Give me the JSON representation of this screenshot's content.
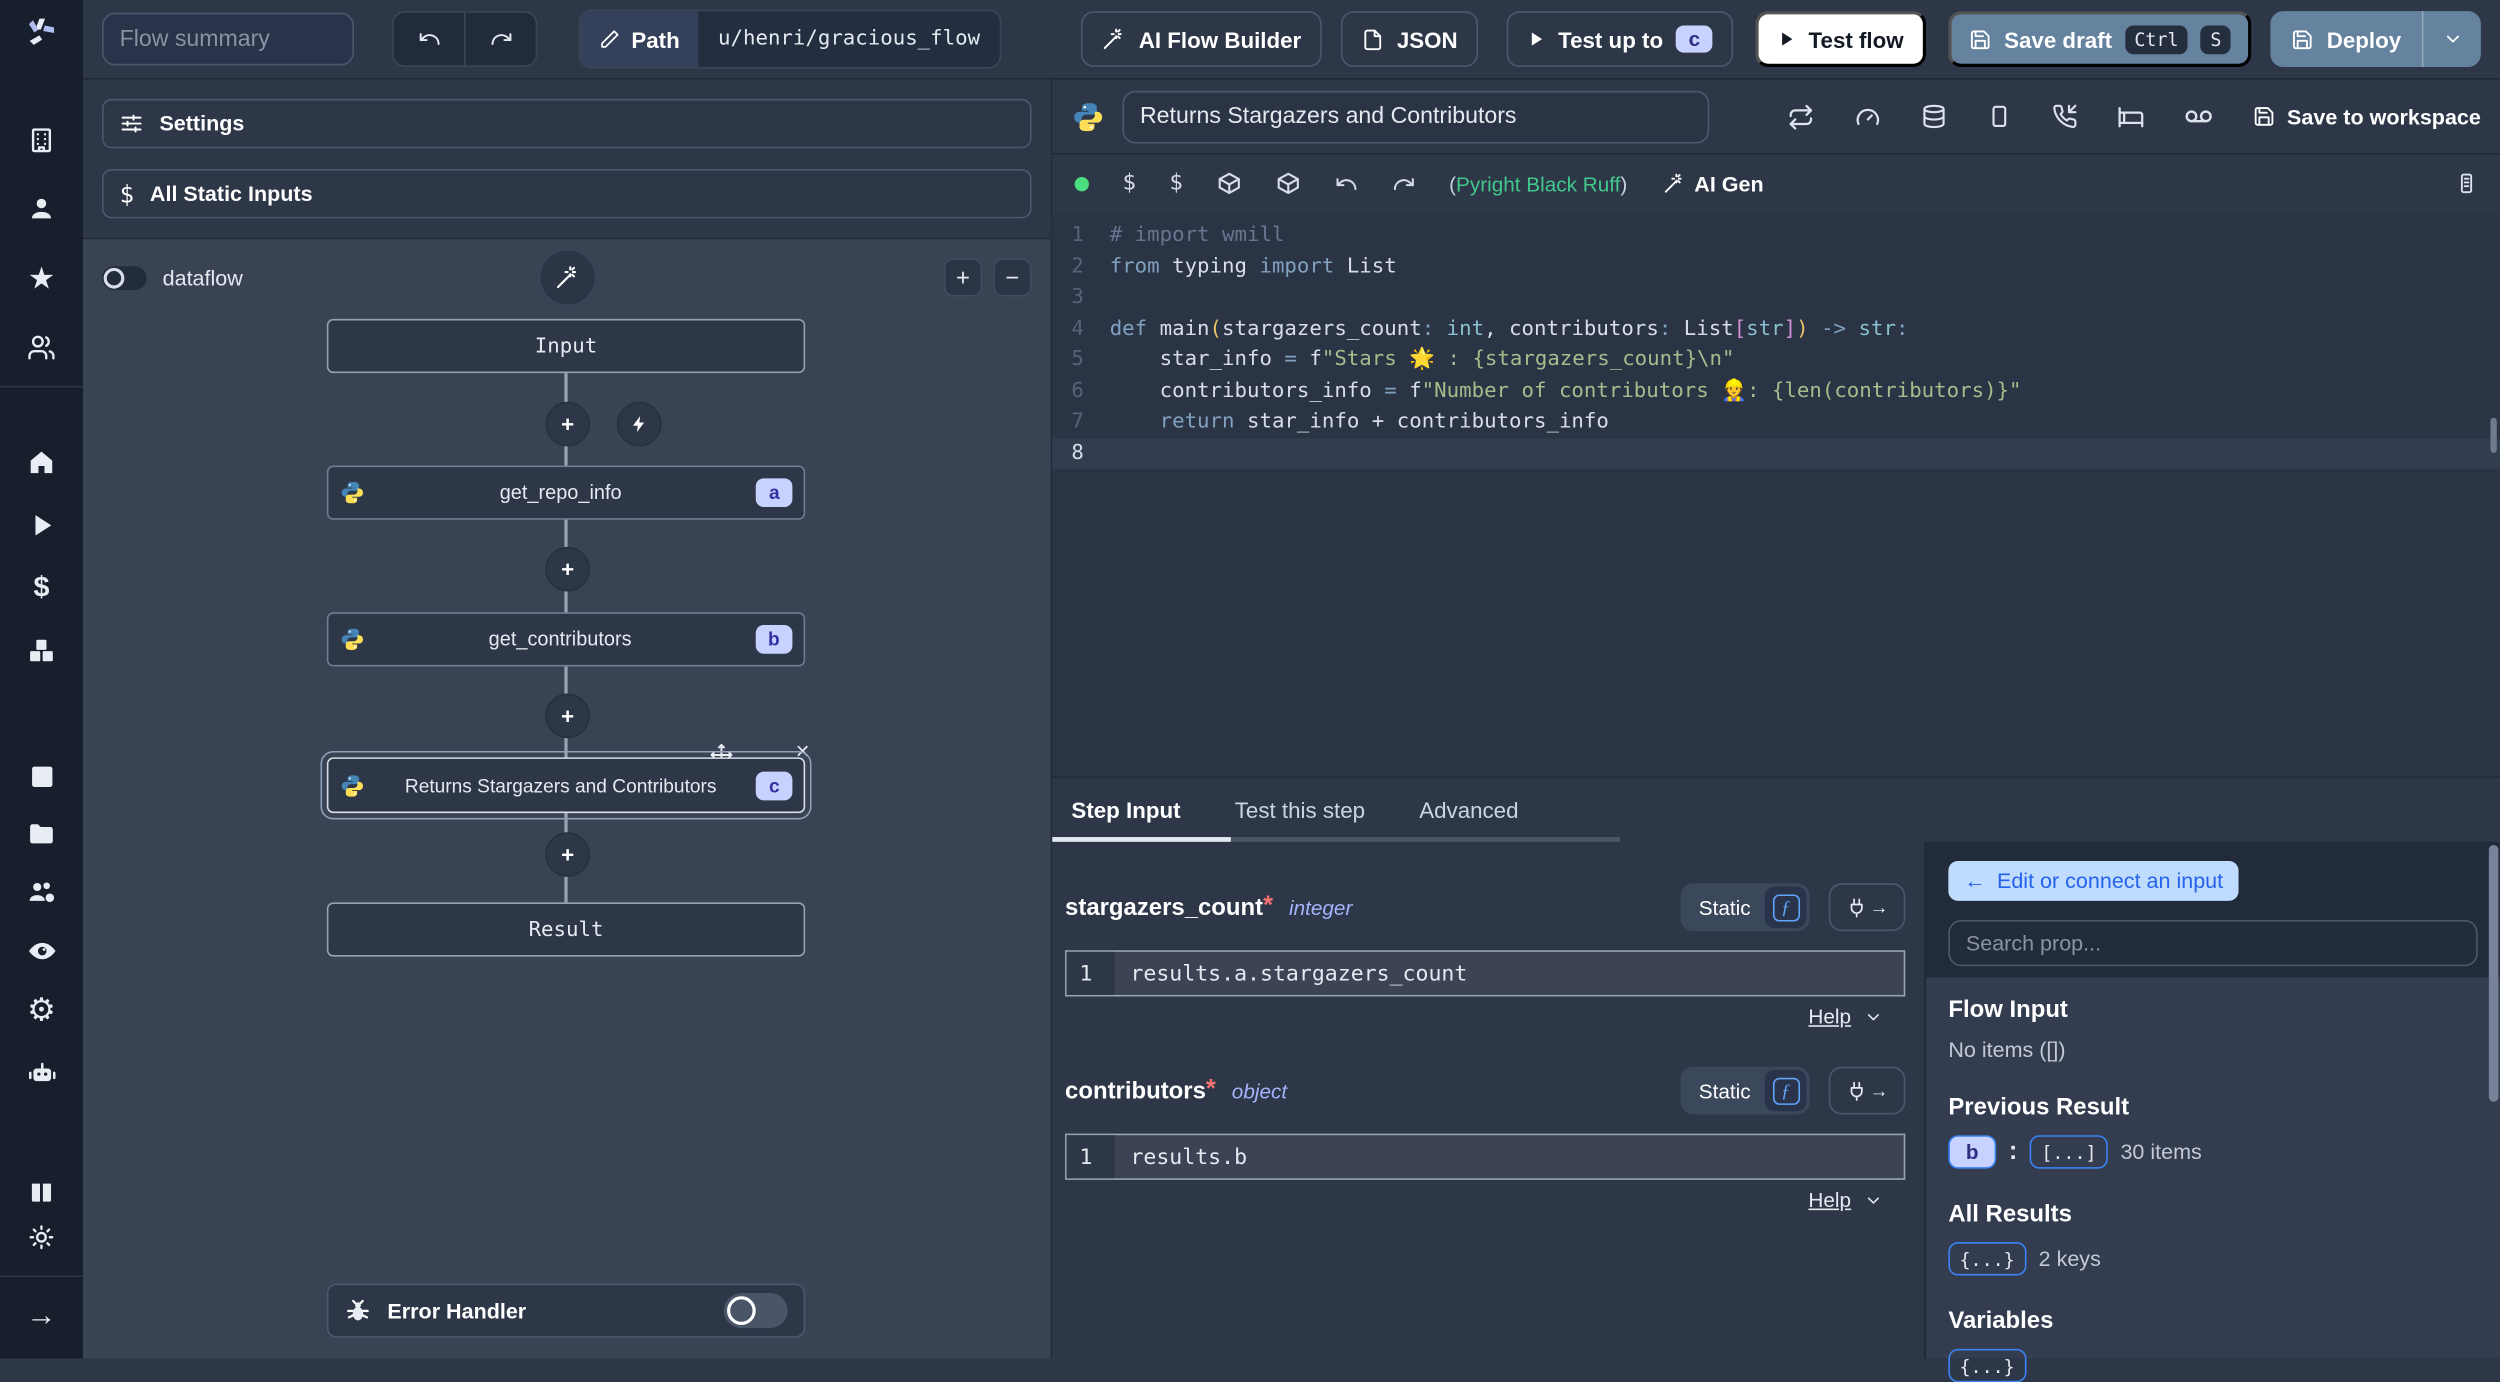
{
  "topbar": {
    "flow_summary_placeholder": "Flow summary",
    "path_label": "Path",
    "path_value": "u/henri/gracious_flow",
    "ai_flow_builder_label": "AI Flow Builder",
    "json_label": "JSON",
    "test_up_to_label": "Test up to",
    "test_up_to_badge": "c",
    "test_flow_label": "Test flow",
    "save_draft_label": "Save draft",
    "kbd_ctrl": "Ctrl",
    "kbd_s": "S",
    "deploy_label": "Deploy"
  },
  "sidebar_icons": [
    "windmill-logo",
    "building",
    "user",
    "star",
    "users",
    "home",
    "play",
    "dollar",
    "boxes",
    "calendar",
    "folder",
    "users-cog",
    "eye",
    "gear",
    "robot",
    "book",
    "sun",
    "arrow-right"
  ],
  "flow": {
    "settings_label": "Settings",
    "static_inputs_label": "All Static Inputs",
    "dataflow_label": "dataflow",
    "plus_label": "+",
    "minus_label": "−",
    "input_label": "Input",
    "result_label": "Result",
    "error_handler_label": "Error Handler",
    "steps": [
      {
        "label": "get_repo_info",
        "badge": "a"
      },
      {
        "label": "get_contributors",
        "badge": "b"
      },
      {
        "label": "Returns Stargazers and Contributors",
        "badge": "c"
      }
    ]
  },
  "editor": {
    "language": "python",
    "title": "Returns Stargazers and Contributors",
    "save_to_workspace_label": "Save to workspace",
    "lint_prefix": "(",
    "lint_text": "Pyright Black Ruff",
    "lint_suffix": ")",
    "ai_gen_label": "AI Gen",
    "dollar1": "$",
    "dollar2": "$"
  },
  "code": {
    "lines": [
      {
        "no": "1",
        "tokens": [
          {
            "c": "comment",
            "t": "# import wmill"
          }
        ]
      },
      {
        "no": "2",
        "tokens": [
          {
            "c": "keyword",
            "t": "from"
          },
          {
            "c": "plain",
            "t": " typing "
          },
          {
            "c": "keyword",
            "t": "import"
          },
          {
            "c": "plain",
            "t": " List"
          }
        ]
      },
      {
        "no": "3",
        "tokens": []
      },
      {
        "no": "4",
        "tokens": [
          {
            "c": "keyword",
            "t": "def"
          },
          {
            "c": "plain",
            "t": " main"
          },
          {
            "c": "paren",
            "t": "("
          },
          {
            "c": "plain",
            "t": "stargazers_count"
          },
          {
            "c": "keyword",
            "t": ":"
          },
          {
            "c": "plain",
            "t": " "
          },
          {
            "c": "type",
            "t": "int"
          },
          {
            "c": "plain",
            "t": ", contributors"
          },
          {
            "c": "keyword",
            "t": ":"
          },
          {
            "c": "plain",
            "t": " List"
          },
          {
            "c": "bracket",
            "t": "["
          },
          {
            "c": "type",
            "t": "str"
          },
          {
            "c": "bracket",
            "t": "]"
          },
          {
            "c": "paren",
            "t": ")"
          },
          {
            "c": "keyword",
            "t": " -> "
          },
          {
            "c": "type",
            "t": "str"
          },
          {
            "c": "keyword",
            "t": ":"
          }
        ]
      },
      {
        "no": "5",
        "tokens": [
          {
            "c": "plain",
            "t": "    star_info "
          },
          {
            "c": "keyword",
            "t": "="
          },
          {
            "c": "plain",
            "t": " f"
          },
          {
            "c": "string",
            "t": "\"Stars 🌟 : {stargazers_count}\\n\""
          }
        ]
      },
      {
        "no": "6",
        "tokens": [
          {
            "c": "plain",
            "t": "    contributors_info "
          },
          {
            "c": "keyword",
            "t": "="
          },
          {
            "c": "plain",
            "t": " f"
          },
          {
            "c": "string",
            "t": "\"Number of contributors 👷: {len(contributors)}\""
          }
        ]
      },
      {
        "no": "7",
        "tokens": [
          {
            "c": "plain",
            "t": "    "
          },
          {
            "c": "keyword",
            "t": "return"
          },
          {
            "c": "plain",
            "t": " star_info + contributors_info"
          }
        ]
      },
      {
        "no": "8",
        "active": true,
        "tokens": []
      }
    ]
  },
  "step_panel": {
    "tabs": [
      {
        "label": "Step Input"
      },
      {
        "label": "Test this step"
      },
      {
        "label": "Advanced"
      }
    ],
    "active_tab": "Step Input",
    "fields": [
      {
        "name": "stargazers_count",
        "required": "*",
        "type": "integer",
        "mode": "Static",
        "line_no": "1",
        "expr": "results.a.stargazers_count",
        "help_label": "Help"
      },
      {
        "name": "contributors",
        "required": "*",
        "type": "object",
        "mode": "Static",
        "line_no": "1",
        "expr": "results.b",
        "help_label": "Help"
      }
    ]
  },
  "connect": {
    "back_arrow": "←",
    "back_label": "Edit or connect an input",
    "search_placeholder": "Search prop...",
    "flow_input_title": "Flow Input",
    "flow_input_empty": "No items ([])",
    "previous_result_title": "Previous Result",
    "previous_result_badge": "b",
    "previous_result_colon": ":",
    "previous_result_preview": "[...]",
    "previous_result_count": "30 items",
    "all_results_title": "All Results",
    "all_results_preview": "{...}",
    "all_results_count": "2 keys",
    "variables_title": "Variables",
    "variables_preview": "{...}"
  },
  "colors": {
    "accent_blue": "#3b82f6",
    "lavender_badge": "#c7d2fe",
    "steel_blue_button": "#65839f",
    "status_green": "#4ade80",
    "lint_green": "#41c98c",
    "required_red": "#f87171",
    "type_purple": "#a5b4fc"
  }
}
